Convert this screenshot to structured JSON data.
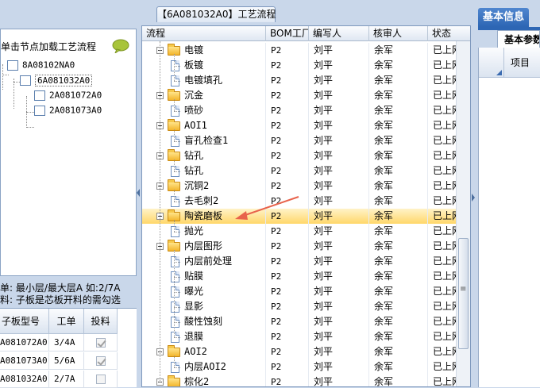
{
  "left_panel": {
    "hint": "单击节点加载工艺流程",
    "tree": [
      {
        "label": "8A08102NA0",
        "level": 0,
        "selected": false
      },
      {
        "label": "6A081032A0",
        "level": 1,
        "selected": true
      },
      {
        "label": "2A081072A0",
        "level": 2,
        "selected": false
      },
      {
        "label": "2A081073A0",
        "level": 2,
        "selected": false
      }
    ],
    "note_line1": "单: 最小层/最大层A 如:2/7A",
    "note_line2": "料: 子板是芯板开料的需勾选",
    "grid": {
      "headers": [
        "子板型号",
        "工单",
        "投料"
      ],
      "rows": [
        {
          "model": "A081072A0",
          "order": "3/4A",
          "feed": true
        },
        {
          "model": "A081073A0",
          "order": "5/6A",
          "feed": true
        },
        {
          "model": "A081032A0",
          "order": "2/7A",
          "feed": false
        }
      ]
    }
  },
  "center_panel": {
    "tab_title": "【6A081032A0】工艺流程",
    "headers": [
      "流程",
      "BOM工厂",
      "编写人",
      "核审人",
      "状态"
    ],
    "rows": [
      {
        "type": "folder",
        "name": "电镀",
        "bom": "P2",
        "writer": "刘平",
        "reviewer": "余军",
        "status": "已上网",
        "highlight": false
      },
      {
        "type": "doc",
        "name": "板镀",
        "bom": "P2",
        "writer": "刘平",
        "reviewer": "余军",
        "status": "已上网",
        "highlight": false
      },
      {
        "type": "doc",
        "name": "电镀填孔",
        "bom": "P2",
        "writer": "刘平",
        "reviewer": "余军",
        "status": "已上网",
        "highlight": false
      },
      {
        "type": "folder",
        "name": "沉金",
        "bom": "P2",
        "writer": "刘平",
        "reviewer": "余军",
        "status": "已上网",
        "highlight": false
      },
      {
        "type": "doc",
        "name": "喷砂",
        "bom": "P2",
        "writer": "刘平",
        "reviewer": "余军",
        "status": "已上网",
        "highlight": false
      },
      {
        "type": "folder",
        "name": "AOI1",
        "bom": "P2",
        "writer": "刘平",
        "reviewer": "余军",
        "status": "已上网",
        "highlight": false
      },
      {
        "type": "doc",
        "name": "盲孔检查1",
        "bom": "P2",
        "writer": "刘平",
        "reviewer": "余军",
        "status": "已上网",
        "highlight": false
      },
      {
        "type": "folder",
        "name": "钻孔",
        "bom": "P2",
        "writer": "刘平",
        "reviewer": "余军",
        "status": "已上网",
        "highlight": false
      },
      {
        "type": "doc",
        "name": "钻孔",
        "bom": "P2",
        "writer": "刘平",
        "reviewer": "余军",
        "status": "已上网",
        "highlight": false
      },
      {
        "type": "folder",
        "name": "沉铜2",
        "bom": "P2",
        "writer": "刘平",
        "reviewer": "余军",
        "status": "已上网",
        "highlight": false
      },
      {
        "type": "doc",
        "name": "去毛刺2",
        "bom": "P2",
        "writer": "刘平",
        "reviewer": "余军",
        "status": "已上网",
        "highlight": false
      },
      {
        "type": "folder",
        "name": "陶瓷磨板",
        "bom": "P2",
        "writer": "刘平",
        "reviewer": "余军",
        "status": "已上网",
        "highlight": true
      },
      {
        "type": "doc",
        "name": "抛光",
        "bom": "P2",
        "writer": "刘平",
        "reviewer": "余军",
        "status": "已上网",
        "highlight": false
      },
      {
        "type": "folder",
        "name": "内层图形",
        "bom": "P2",
        "writer": "刘平",
        "reviewer": "余军",
        "status": "已上网",
        "highlight": false
      },
      {
        "type": "doc",
        "name": "内层前处理",
        "bom": "P2",
        "writer": "刘平",
        "reviewer": "余军",
        "status": "已上网",
        "highlight": false
      },
      {
        "type": "doc",
        "name": "贴膜",
        "bom": "P2",
        "writer": "刘平",
        "reviewer": "余军",
        "status": "已上网",
        "highlight": false
      },
      {
        "type": "doc",
        "name": "曝光",
        "bom": "P2",
        "writer": "刘平",
        "reviewer": "余军",
        "status": "已上网",
        "highlight": false
      },
      {
        "type": "doc",
        "name": "显影",
        "bom": "P2",
        "writer": "刘平",
        "reviewer": "余军",
        "status": "已上网",
        "highlight": false
      },
      {
        "type": "doc",
        "name": "酸性蚀刻",
        "bom": "P2",
        "writer": "刘平",
        "reviewer": "余军",
        "status": "已上网",
        "highlight": false
      },
      {
        "type": "doc",
        "name": "退膜",
        "bom": "P2",
        "writer": "刘平",
        "reviewer": "余军",
        "status": "已上网",
        "highlight": false
      },
      {
        "type": "folder",
        "name": "AOI2",
        "bom": "P2",
        "writer": "刘平",
        "reviewer": "余军",
        "status": "已上网",
        "highlight": false
      },
      {
        "type": "doc",
        "name": "内层AOI2",
        "bom": "P2",
        "writer": "刘平",
        "reviewer": "余军",
        "status": "已上网",
        "highlight": false
      },
      {
        "type": "folder",
        "name": "棕化2",
        "bom": "P2",
        "writer": "刘平",
        "reviewer": "余军",
        "status": "已上网",
        "highlight": false
      }
    ]
  },
  "right_panel": {
    "tab_label": "基本信息",
    "subtab_label": "基本参数",
    "grid_header": "项目"
  },
  "colors": {
    "accent": "#2d66b4",
    "highlight_row": "#ffd76a",
    "annotation_arrow": "#e8634c",
    "panel_bg": "#c9d7ea"
  }
}
